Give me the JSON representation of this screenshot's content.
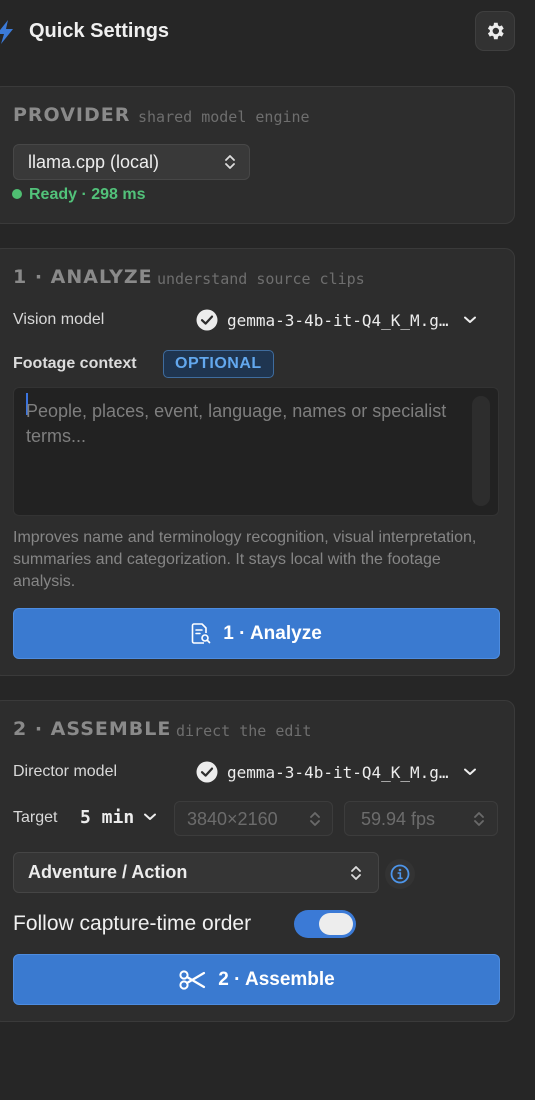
{
  "header": {
    "title": "Quick Settings"
  },
  "provider": {
    "title": "PROVIDER",
    "subtitle": "shared model engine",
    "selected": "llama.cpp (local)",
    "status": "Ready · 298 ms"
  },
  "analyze": {
    "title": "1 · ANALYZE",
    "subtitle": "understand source clips",
    "vision_label": "Vision model",
    "vision_value": "gemma-3-4b-it-Q4_K_M.g…",
    "context_label": "Footage context",
    "context_badge": "OPTIONAL",
    "context_placeholder": "People, places, event, language, names or specialist terms...",
    "help_text": "Improves name and terminology recognition, visual interpretation, summaries and categorization. It stays local with the footage analysis.",
    "button_label": "1 · Analyze"
  },
  "assemble": {
    "title": "2 · ASSEMBLE",
    "subtitle": "direct the edit",
    "director_label": "Director model",
    "director_value": "gemma-3-4b-it-Q4_K_M.g…",
    "target_label": "Target",
    "target_value": "5 min",
    "resolution": "3840×2160",
    "fps": "59.94 fps",
    "style": "Adventure / Action",
    "order_label": "Follow capture-time order",
    "order_enabled": true,
    "button_label": "2 · Assemble"
  },
  "colors": {
    "accent": "#3a7ad0",
    "ready": "#52c27a",
    "badge": "#63a8ee"
  }
}
